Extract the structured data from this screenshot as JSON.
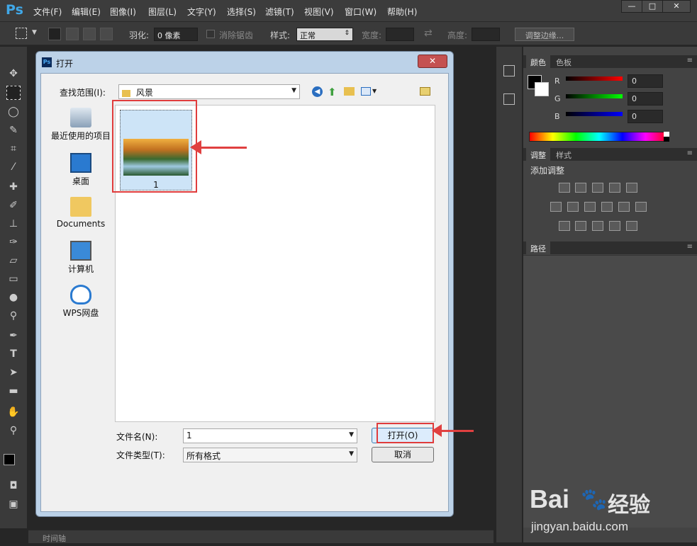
{
  "app": {
    "logo": "Ps",
    "menu": [
      "文件(F)",
      "编辑(E)",
      "图像(I)",
      "图层(L)",
      "文字(Y)",
      "选择(S)",
      "滤镜(T)",
      "视图(V)",
      "窗口(W)",
      "帮助(H)"
    ],
    "window_buttons": [
      "—",
      "□",
      "✕"
    ]
  },
  "options_bar": {
    "feather_label": "羽化:",
    "feather_value": "0 像素",
    "antialias_label": "消除锯齿",
    "style_label": "样式:",
    "style_value": "正常",
    "width_label": "宽度:",
    "height_label": "高度:",
    "refine_edge_label": "调整边缘..."
  },
  "right_panels": {
    "color_tabs": [
      "颜色",
      "色板"
    ],
    "channels": [
      {
        "label": "R",
        "value": "0",
        "color": "#d02020"
      },
      {
        "label": "G",
        "value": "0",
        "color": "#20b030"
      },
      {
        "label": "B",
        "value": "0",
        "color": "#2030d0"
      }
    ],
    "adjust_tabs": [
      "调整",
      "样式"
    ],
    "adjust_title": "添加调整",
    "paths_tab": "路径"
  },
  "bottom": {
    "timeline_label": "时间轴"
  },
  "dialog": {
    "title": "打开",
    "look_in_label": "查找范围(I):",
    "look_in_value": "风景",
    "places": [
      {
        "label": "最近使用的项目",
        "icon": "recent-items-icon"
      },
      {
        "label": "桌面",
        "icon": "desktop-icon"
      },
      {
        "label": "Documents",
        "icon": "documents-folder-icon"
      },
      {
        "label": "计算机",
        "icon": "computer-icon"
      },
      {
        "label": "WPS网盘",
        "icon": "cloud-icon"
      }
    ],
    "file": {
      "name": "1",
      "icon": "image-thumbnail"
    },
    "filename_label": "文件名(N):",
    "filename_value": "1",
    "filetype_label": "文件类型(T):",
    "filetype_value": "所有格式",
    "open_button": "打开(O)",
    "cancel_button": "取消"
  },
  "watermark": {
    "brand": "Bai",
    "brand_suffix": "经验",
    "url": "jingyan.baidu.com"
  }
}
